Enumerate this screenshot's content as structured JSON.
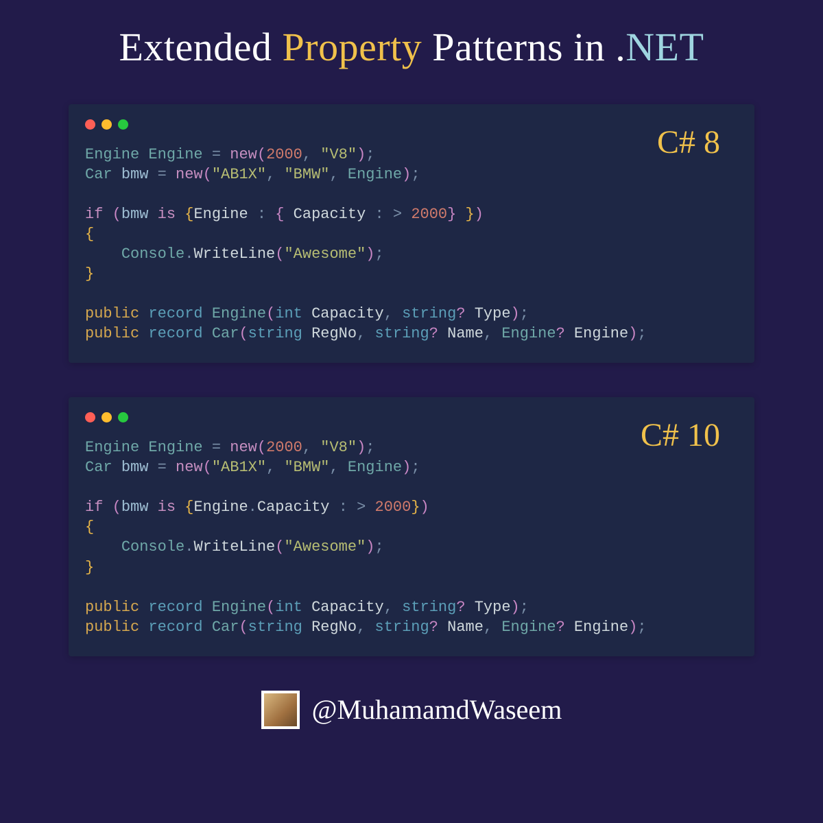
{
  "title": {
    "part1": "Extended ",
    "accent1": "Property",
    "part2": " Patterns in .",
    "accent2": "NET"
  },
  "panels": [
    {
      "version": "C# 8",
      "tokens": [
        [
          [
            "tk-type",
            "Engine"
          ],
          [
            "",
            " "
          ],
          [
            "tk-type",
            "Engine"
          ],
          [
            "",
            " "
          ],
          [
            "tk-op",
            "="
          ],
          [
            "",
            " "
          ],
          [
            "tk-kw",
            "new"
          ],
          [
            "tk-paren",
            "("
          ],
          [
            "tk-num",
            "2000"
          ],
          [
            "tk-punc",
            ","
          ],
          [
            "",
            " "
          ],
          [
            "tk-str",
            "\"V8\""
          ],
          [
            "tk-paren",
            ")"
          ],
          [
            "tk-punc",
            ";"
          ]
        ],
        [
          [
            "tk-type",
            "Car"
          ],
          [
            "",
            " "
          ],
          [
            "tk-var",
            "bmw"
          ],
          [
            "",
            " "
          ],
          [
            "tk-op",
            "="
          ],
          [
            "",
            " "
          ],
          [
            "tk-kw",
            "new"
          ],
          [
            "tk-paren",
            "("
          ],
          [
            "tk-str",
            "\"AB1X\""
          ],
          [
            "tk-punc",
            ","
          ],
          [
            "",
            " "
          ],
          [
            "tk-str",
            "\"BMW\""
          ],
          [
            "tk-punc",
            ","
          ],
          [
            "",
            " "
          ],
          [
            "tk-type",
            "Engine"
          ],
          [
            "tk-paren",
            ")"
          ],
          [
            "tk-punc",
            ";"
          ]
        ],
        [],
        [
          [
            "tk-kw",
            "if"
          ],
          [
            "",
            " "
          ],
          [
            "tk-paren",
            "("
          ],
          [
            "tk-var",
            "bmw"
          ],
          [
            "",
            " "
          ],
          [
            "tk-kw",
            "is"
          ],
          [
            "",
            " "
          ],
          [
            "tk-brace",
            "{"
          ],
          [
            "tk-prop",
            "Engine"
          ],
          [
            "",
            " "
          ],
          [
            "tk-punc",
            ":"
          ],
          [
            "",
            " "
          ],
          [
            "tk-paren",
            "{"
          ],
          [
            "",
            " "
          ],
          [
            "tk-prop",
            "Capacity"
          ],
          [
            "",
            " "
          ],
          [
            "tk-punc",
            ":"
          ],
          [
            "",
            " "
          ],
          [
            "tk-op",
            ">"
          ],
          [
            "",
            " "
          ],
          [
            "tk-num",
            "2000"
          ],
          [
            "tk-paren",
            "}"
          ],
          [
            "",
            " "
          ],
          [
            "tk-brace",
            "}"
          ],
          [
            "tk-paren",
            ")"
          ]
        ],
        [
          [
            "tk-brace",
            "{"
          ]
        ],
        [
          [
            "",
            "    "
          ],
          [
            "tk-type",
            "Console"
          ],
          [
            "tk-punc",
            "."
          ],
          [
            "tk-ident",
            "WriteLine"
          ],
          [
            "tk-paren",
            "("
          ],
          [
            "tk-str",
            "\"Awesome\""
          ],
          [
            "tk-paren",
            ")"
          ],
          [
            "tk-punc",
            ";"
          ]
        ],
        [
          [
            "tk-brace",
            "}"
          ]
        ],
        [],
        [
          [
            "tk-pubkw",
            "public"
          ],
          [
            "",
            " "
          ],
          [
            "tk-record",
            "record"
          ],
          [
            "",
            " "
          ],
          [
            "tk-type",
            "Engine"
          ],
          [
            "tk-paren",
            "("
          ],
          [
            "tk-record",
            "int"
          ],
          [
            "",
            " "
          ],
          [
            "tk-ident",
            "Capacity"
          ],
          [
            "tk-punc",
            ","
          ],
          [
            "",
            " "
          ],
          [
            "tk-record",
            "string"
          ],
          [
            "tk-q",
            "?"
          ],
          [
            "",
            " "
          ],
          [
            "tk-ident",
            "Type"
          ],
          [
            "tk-paren",
            ")"
          ],
          [
            "tk-punc",
            ";"
          ]
        ],
        [
          [
            "tk-pubkw",
            "public"
          ],
          [
            "",
            " "
          ],
          [
            "tk-record",
            "record"
          ],
          [
            "",
            " "
          ],
          [
            "tk-type",
            "Car"
          ],
          [
            "tk-paren",
            "("
          ],
          [
            "tk-record",
            "string"
          ],
          [
            "",
            " "
          ],
          [
            "tk-ident",
            "RegNo"
          ],
          [
            "tk-punc",
            ","
          ],
          [
            "",
            " "
          ],
          [
            "tk-record",
            "string"
          ],
          [
            "tk-q",
            "?"
          ],
          [
            "",
            " "
          ],
          [
            "tk-ident",
            "Name"
          ],
          [
            "tk-punc",
            ","
          ],
          [
            "",
            " "
          ],
          [
            "tk-type",
            "Engine"
          ],
          [
            "tk-q",
            "?"
          ],
          [
            "",
            " "
          ],
          [
            "tk-ident",
            "Engine"
          ],
          [
            "tk-paren",
            ")"
          ],
          [
            "tk-punc",
            ";"
          ]
        ]
      ]
    },
    {
      "version": "C# 10",
      "tokens": [
        [
          [
            "tk-type",
            "Engine"
          ],
          [
            "",
            " "
          ],
          [
            "tk-type",
            "Engine"
          ],
          [
            "",
            " "
          ],
          [
            "tk-op",
            "="
          ],
          [
            "",
            " "
          ],
          [
            "tk-kw",
            "new"
          ],
          [
            "tk-paren",
            "("
          ],
          [
            "tk-num",
            "2000"
          ],
          [
            "tk-punc",
            ","
          ],
          [
            "",
            " "
          ],
          [
            "tk-str",
            "\"V8\""
          ],
          [
            "tk-paren",
            ")"
          ],
          [
            "tk-punc",
            ";"
          ]
        ],
        [
          [
            "tk-type",
            "Car"
          ],
          [
            "",
            " "
          ],
          [
            "tk-var",
            "bmw"
          ],
          [
            "",
            " "
          ],
          [
            "tk-op",
            "="
          ],
          [
            "",
            " "
          ],
          [
            "tk-kw",
            "new"
          ],
          [
            "tk-paren",
            "("
          ],
          [
            "tk-str",
            "\"AB1X\""
          ],
          [
            "tk-punc",
            ","
          ],
          [
            "",
            " "
          ],
          [
            "tk-str",
            "\"BMW\""
          ],
          [
            "tk-punc",
            ","
          ],
          [
            "",
            " "
          ],
          [
            "tk-type",
            "Engine"
          ],
          [
            "tk-paren",
            ")"
          ],
          [
            "tk-punc",
            ";"
          ]
        ],
        [],
        [
          [
            "tk-kw",
            "if"
          ],
          [
            "",
            " "
          ],
          [
            "tk-paren",
            "("
          ],
          [
            "tk-var",
            "bmw"
          ],
          [
            "",
            " "
          ],
          [
            "tk-kw",
            "is"
          ],
          [
            "",
            " "
          ],
          [
            "tk-brace",
            "{"
          ],
          [
            "tk-prop",
            "Engine"
          ],
          [
            "tk-punc",
            "."
          ],
          [
            "tk-prop",
            "Capacity"
          ],
          [
            "",
            " "
          ],
          [
            "tk-punc",
            ":"
          ],
          [
            "",
            " "
          ],
          [
            "tk-op",
            ">"
          ],
          [
            "",
            " "
          ],
          [
            "tk-num",
            "2000"
          ],
          [
            "tk-brace",
            "}"
          ],
          [
            "tk-paren",
            ")"
          ]
        ],
        [
          [
            "tk-brace",
            "{"
          ]
        ],
        [
          [
            "",
            "    "
          ],
          [
            "tk-type",
            "Console"
          ],
          [
            "tk-punc",
            "."
          ],
          [
            "tk-ident",
            "WriteLine"
          ],
          [
            "tk-paren",
            "("
          ],
          [
            "tk-str",
            "\"Awesome\""
          ],
          [
            "tk-paren",
            ")"
          ],
          [
            "tk-punc",
            ";"
          ]
        ],
        [
          [
            "tk-brace",
            "}"
          ]
        ],
        [],
        [
          [
            "tk-pubkw",
            "public"
          ],
          [
            "",
            " "
          ],
          [
            "tk-record",
            "record"
          ],
          [
            "",
            " "
          ],
          [
            "tk-type",
            "Engine"
          ],
          [
            "tk-paren",
            "("
          ],
          [
            "tk-record",
            "int"
          ],
          [
            "",
            " "
          ],
          [
            "tk-ident",
            "Capacity"
          ],
          [
            "tk-punc",
            ","
          ],
          [
            "",
            " "
          ],
          [
            "tk-record",
            "string"
          ],
          [
            "tk-q",
            "?"
          ],
          [
            "",
            " "
          ],
          [
            "tk-ident",
            "Type"
          ],
          [
            "tk-paren",
            ")"
          ],
          [
            "tk-punc",
            ";"
          ]
        ],
        [
          [
            "tk-pubkw",
            "public"
          ],
          [
            "",
            " "
          ],
          [
            "tk-record",
            "record"
          ],
          [
            "",
            " "
          ],
          [
            "tk-type",
            "Car"
          ],
          [
            "tk-paren",
            "("
          ],
          [
            "tk-record",
            "string"
          ],
          [
            "",
            " "
          ],
          [
            "tk-ident",
            "RegNo"
          ],
          [
            "tk-punc",
            ","
          ],
          [
            "",
            " "
          ],
          [
            "tk-record",
            "string"
          ],
          [
            "tk-q",
            "?"
          ],
          [
            "",
            " "
          ],
          [
            "tk-ident",
            "Name"
          ],
          [
            "tk-punc",
            ","
          ],
          [
            "",
            " "
          ],
          [
            "tk-type",
            "Engine"
          ],
          [
            "tk-q",
            "?"
          ],
          [
            "",
            " "
          ],
          [
            "tk-ident",
            "Engine"
          ],
          [
            "tk-paren",
            ")"
          ],
          [
            "tk-punc",
            ";"
          ]
        ]
      ]
    }
  ],
  "footer": {
    "handle": "@MuhamamdWaseem"
  }
}
